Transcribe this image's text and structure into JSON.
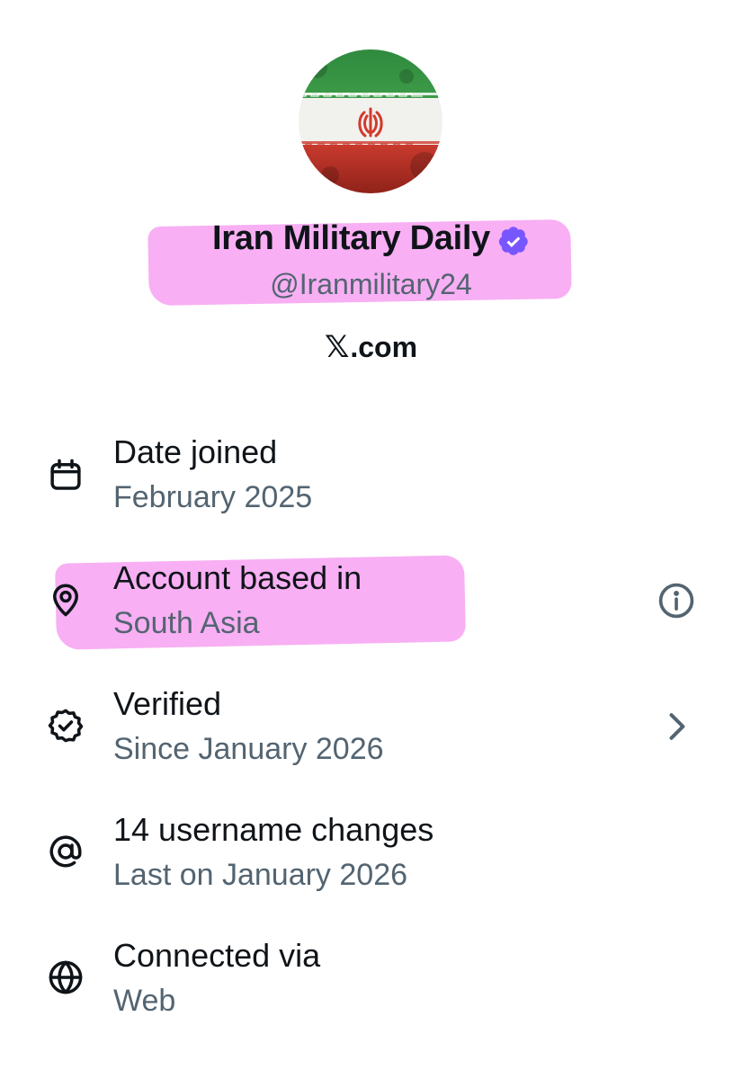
{
  "profile": {
    "display_name": "Iran Military Daily",
    "handle": "@Iranmilitary24",
    "site_label": ".com",
    "site_logo": "𝕏",
    "avatar_icon": "iran-flag-icon",
    "verified_icon": "verified-badge-icon",
    "verified_color": "#7856ff"
  },
  "highlight_color": "#f7a6f2",
  "info": [
    {
      "icon": "calendar-icon",
      "title": "Date joined",
      "subtitle": "February 2025"
    },
    {
      "icon": "location-pin-icon",
      "title": "Account based in",
      "subtitle": "South Asia",
      "trailing_icon": "info-circle-icon"
    },
    {
      "icon": "verified-outline-icon",
      "title": "Verified",
      "subtitle": "Since January 2026",
      "trailing_icon": "chevron-right-icon"
    },
    {
      "icon": "at-sign-icon",
      "title": "14 username changes",
      "subtitle": "Last on January 2026"
    },
    {
      "icon": "globe-icon",
      "title": "Connected via",
      "subtitle": "Web"
    }
  ]
}
